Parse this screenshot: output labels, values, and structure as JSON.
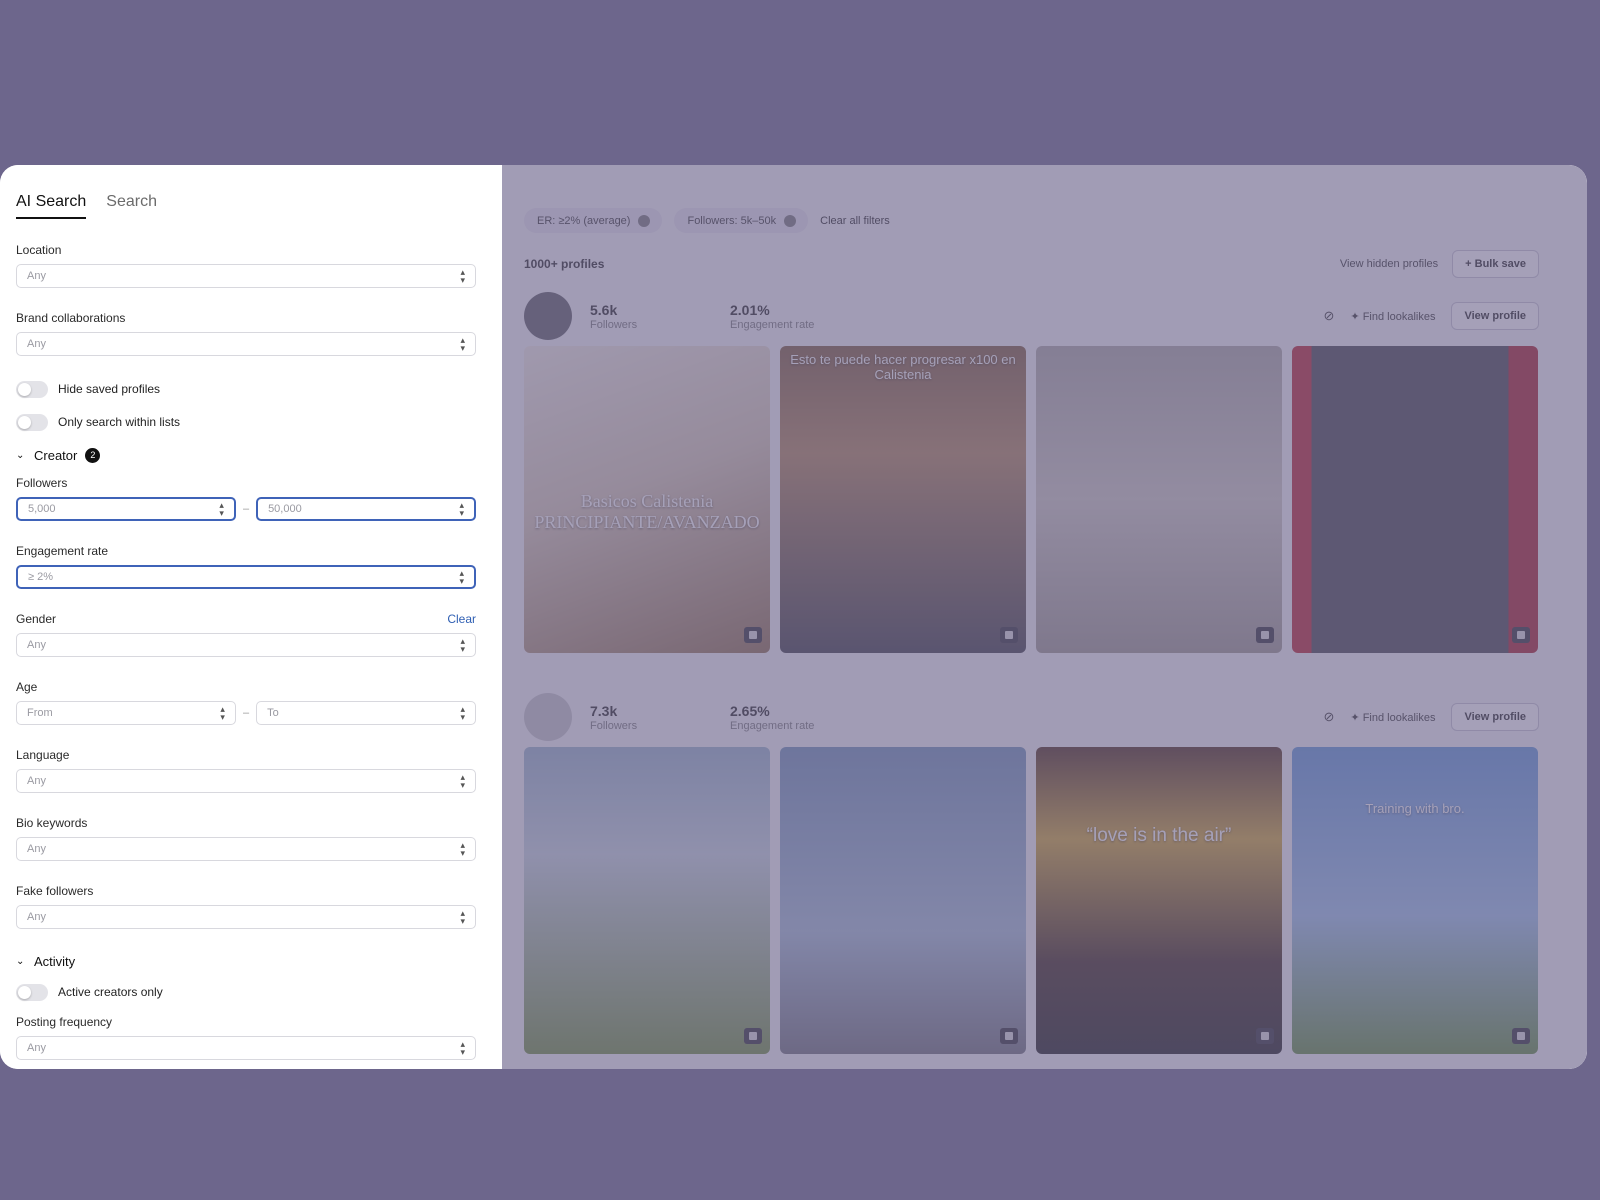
{
  "tabs": [
    {
      "label": "AI Search",
      "active": true
    },
    {
      "label": "Search",
      "active": false
    }
  ],
  "filters": {
    "location": {
      "label": "Location",
      "value": "Any"
    },
    "brand": {
      "label": "Brand collaborations",
      "value": "Any"
    },
    "hide_saved": "Hide saved profiles",
    "only_lists": "Only search within lists",
    "creator_section": {
      "label": "Creator",
      "badge": "2"
    },
    "followers": {
      "label": "Followers",
      "from": "5,000",
      "to": "50,000"
    },
    "engagement": {
      "label": "Engagement rate",
      "value": "≥ 2%"
    },
    "gender": {
      "label": "Gender",
      "clear": "Clear",
      "value": "Any"
    },
    "age": {
      "label": "Age",
      "from": "From",
      "to": "To"
    },
    "language": {
      "label": "Language",
      "value": "Any"
    },
    "bio": {
      "label": "Bio keywords",
      "value": "Any"
    },
    "fake": {
      "label": "Fake followers",
      "value": "Any"
    },
    "activity_section": {
      "label": "Activity"
    },
    "active_only": "Active creators only",
    "posting": {
      "label": "Posting frequency",
      "value": "Any"
    }
  },
  "chips": [
    "ER: ≥2% (average)",
    "Followers: 5k–50k"
  ],
  "clear_all": "Clear all filters",
  "results": {
    "count": "1000+ profiles",
    "view_hidden": "View hidden profiles",
    "bulk_save": "+ Bulk save"
  },
  "profiles": [
    {
      "followers": "5.6k",
      "followers_label": "Followers",
      "er": "2.01%",
      "er_label": "Engagement rate",
      "find": "Find lookalikes",
      "view": "View profile",
      "captions": [
        "Basicos Calistenia PRINCIPIANTE/AVANZADO",
        "Esto te puede hacer progresar x100 en Calistenia",
        "",
        ""
      ]
    },
    {
      "followers": "7.3k",
      "followers_label": "Followers",
      "er": "2.65%",
      "er_label": "Engagement rate",
      "find": "Find lookalikes",
      "view": "View profile",
      "captions": [
        "",
        "",
        "“love is in the air”",
        "Training with bro."
      ]
    }
  ],
  "colors": {
    "accent": "#3f63b8",
    "backdrop": "#6d668c"
  },
  "icons": {
    "hide": "eye-off-icon",
    "sparkle": "sparkle-icon",
    "video": "video-icon",
    "chevron": "chevron-updown-icon"
  }
}
